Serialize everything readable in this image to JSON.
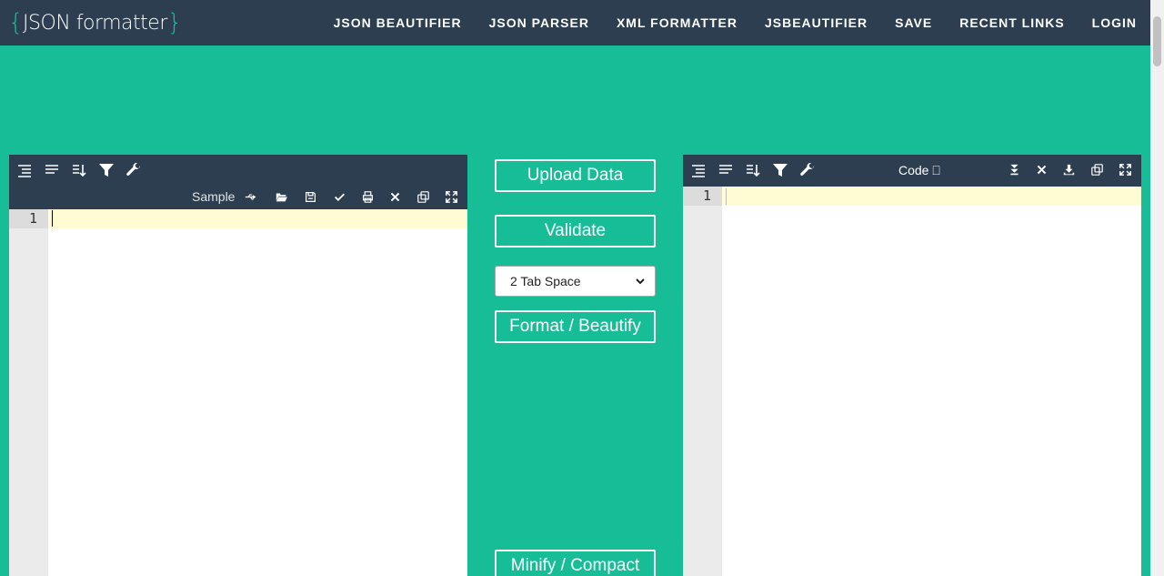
{
  "logo": {
    "open_brace": "{",
    "text": "JSON formatter",
    "close_brace": "}"
  },
  "nav": [
    "JSON BEAUTIFIER",
    "JSON PARSER",
    "XML FORMATTER",
    "JSBEAUTIFIER",
    "SAVE",
    "RECENT LINKS",
    "LOGIN"
  ],
  "left_editor": {
    "sample_label": "Sample",
    "line_numbers": [
      "1"
    ]
  },
  "right_editor": {
    "mode_label": "Code ⎕",
    "line_numbers": [
      "1"
    ]
  },
  "controls": {
    "upload": "Upload Data",
    "validate": "Validate",
    "indent_selected": "2 Tab Space",
    "format": "Format / Beautify",
    "minify": "Minify / Compact"
  },
  "colors": {
    "accent": "#17bd97",
    "navbar": "#2c3e50",
    "active_line": "#fffbd2",
    "gutter": "#ebebeb"
  },
  "icons": {
    "left_toolbar": [
      "format-icon",
      "compact-icon",
      "sort-icon",
      "filter-icon",
      "repair-wrench-icon"
    ],
    "left_actions": [
      "usb-icon",
      "open-folder-icon",
      "save-icon",
      "check-icon",
      "print-icon",
      "close-icon",
      "copy-icon",
      "fullscreen-icon"
    ],
    "right_toolbar": [
      "format-icon",
      "compact-icon",
      "sort-icon",
      "filter-icon",
      "repair-wrench-icon"
    ],
    "right_actions": [
      "collapse-all-icon",
      "close-icon",
      "download-icon",
      "copy-icon",
      "fullscreen-icon"
    ]
  }
}
